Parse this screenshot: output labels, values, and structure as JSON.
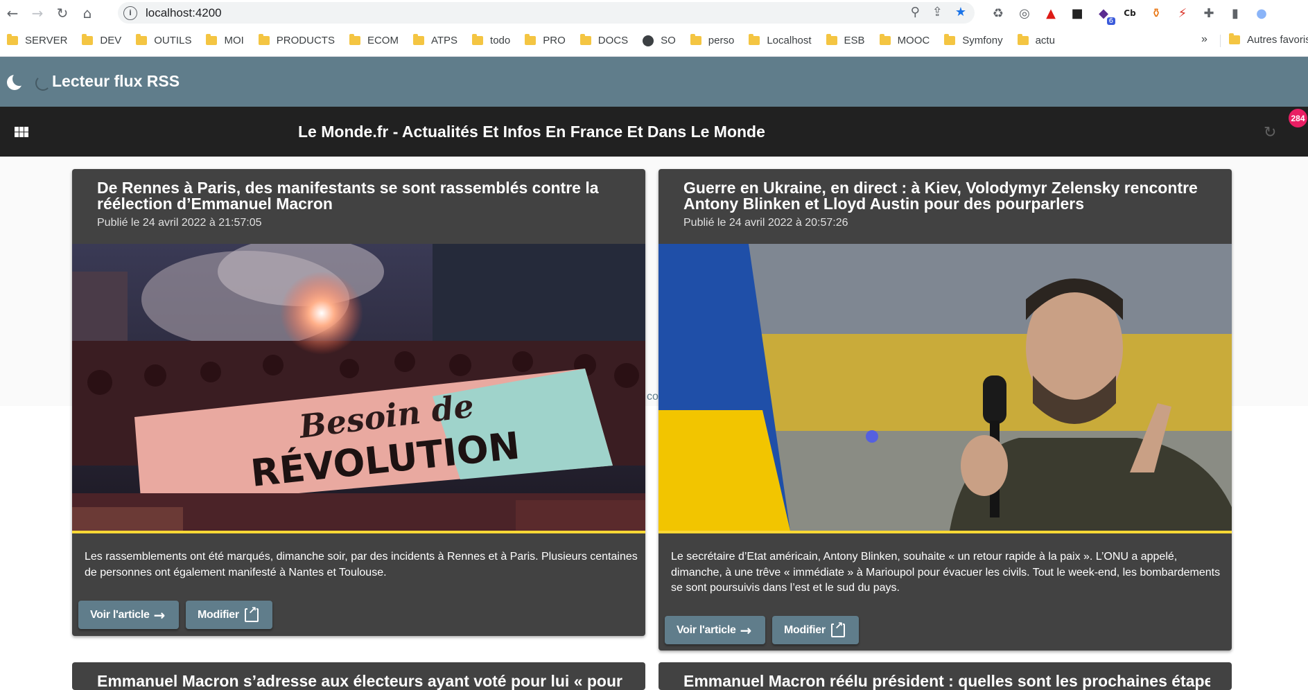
{
  "browser": {
    "url": "localhost:4200",
    "bookmarks": [
      "SERVER",
      "DEV",
      "OUTILS",
      "MOI",
      "PRODUCTS",
      "ECOM",
      "ATPS",
      "todo",
      "PRO",
      "DOCS",
      "SO",
      "perso",
      "Localhost",
      "ESB",
      "MOOC",
      "Symfony",
      "actu"
    ],
    "more": "»",
    "other_bookmarks": "Autres favoris",
    "extension_count": "6",
    "extension_cb": "Cb"
  },
  "app": {
    "title": "Lecteur flux RSS"
  },
  "feed": {
    "title": "Le Monde.fr - Actualités Et Infos En France Et Dans Le Monde",
    "unread_count": "284"
  },
  "articles": [
    {
      "title": "De Rennes à Paris, des manifestants se sont rassemblés contre la réélection d’Emmanuel Macron",
      "date": "Publié le 24 avril 2022 à 21:57:05",
      "banner_text_1": "Besoin de",
      "banner_text_2": "RÉVOLUTION",
      "description": "Les rassemblements ont été marqués, dimanche soir, par des incidents à Rennes et à Paris. Plusieurs centaines de personnes ont également manifesté à Nantes et Toulouse.",
      "view_label": "Voir l'article",
      "edit_label": "Modifier"
    },
    {
      "title": "Guerre en Ukraine, en direct : à Kiev, Volodymyr Zelensky rencontre Antony Blinken et Lloyd Austin pour des pourparlers",
      "date": "Publié le 24 avril 2022 à 20:57:26",
      "description": "Le secrétaire d’Etat américain, Antony Blinken, souhaite « un retour rapide à la paix ». L’ONU a appelé, dimanche, à une trêve « immédiate » à Marioupol pour évacuer les civils. Tout le week-end, les bombardements se sont poursuivis dans l’est et le sud du pays.",
      "view_label": "Voir l'article",
      "edit_label": "Modifier"
    },
    {
      "title": "Emmanuel Macron s’adresse aux électeurs ayant voté pour lui « pour faire"
    },
    {
      "title": "Emmanuel Macron réélu président : quelles sont les prochaines étapes"
    }
  ],
  "stray_text": "co",
  "colors": {
    "toolbar": "#607d8b",
    "feed_bar": "#212121",
    "card": "#424242",
    "accent_line": "#fdd835",
    "badge": "#e91e63"
  }
}
